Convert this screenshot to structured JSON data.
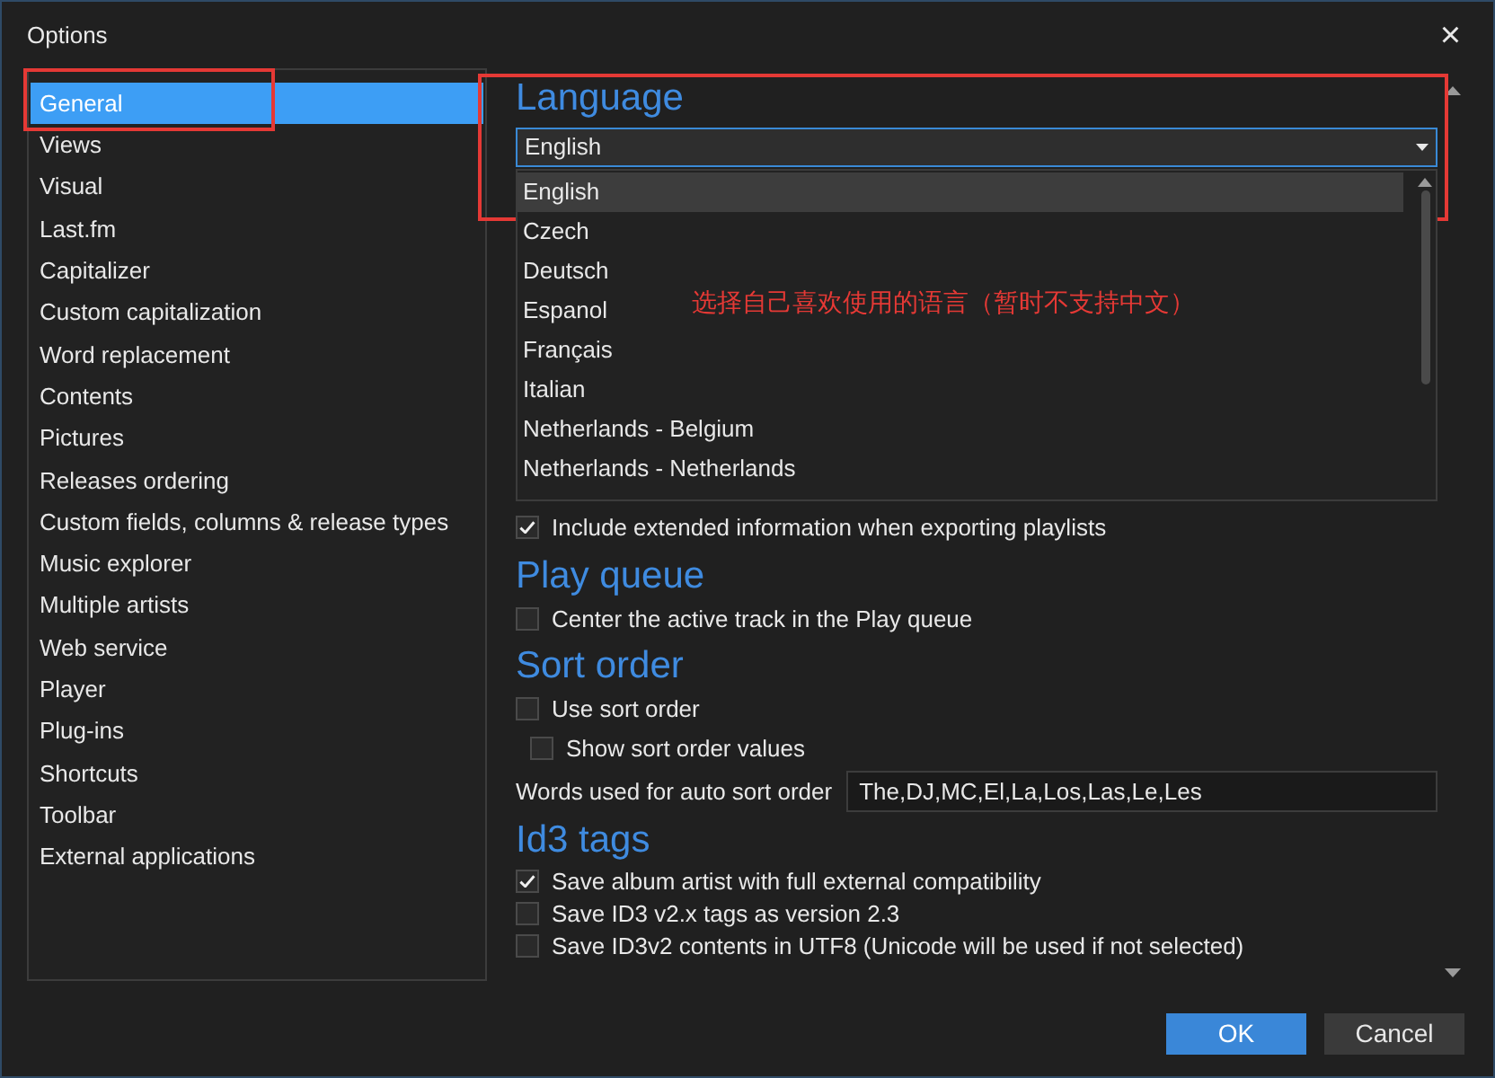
{
  "window": {
    "title": "Options",
    "close": "×"
  },
  "sidebar": {
    "items": [
      {
        "label": "General",
        "selected": true
      },
      {
        "label": "Views",
        "selected": false
      },
      {
        "label": "Visual",
        "selected": false
      },
      {
        "label": "Last.fm",
        "selected": false
      },
      {
        "label": "Capitalizer",
        "selected": false
      },
      {
        "label": "Custom capitalization",
        "selected": false
      },
      {
        "label": "Word replacement",
        "selected": false
      },
      {
        "label": "Contents",
        "selected": false
      },
      {
        "label": "Pictures",
        "selected": false
      },
      {
        "label": "Releases ordering",
        "selected": false
      },
      {
        "label": "Custom fields, columns & release types",
        "selected": false
      },
      {
        "label": "Music explorer",
        "selected": false
      },
      {
        "label": "Multiple artists",
        "selected": false
      },
      {
        "label": "Web service",
        "selected": false
      },
      {
        "label": "Player",
        "selected": false
      },
      {
        "label": "Plug-ins",
        "selected": false
      },
      {
        "label": "Shortcuts",
        "selected": false
      },
      {
        "label": "Toolbar",
        "selected": false
      },
      {
        "label": "External applications",
        "selected": false
      }
    ]
  },
  "language": {
    "heading": "Language",
    "value": "English",
    "expanded": true,
    "options": [
      {
        "label": "English",
        "selected": true
      },
      {
        "label": "Czech",
        "selected": false
      },
      {
        "label": "Deutsch",
        "selected": false
      },
      {
        "label": "Espanol",
        "selected": false
      },
      {
        "label": "Français",
        "selected": false
      },
      {
        "label": "Italian",
        "selected": false
      },
      {
        "label": "Netherlands - Belgium",
        "selected": false
      },
      {
        "label": "Netherlands - Netherlands",
        "selected": false
      }
    ]
  },
  "general_options": [
    {
      "label": "Include extended information when exporting playlists",
      "checked": true
    }
  ],
  "play_queue": {
    "heading": "Play queue",
    "options": [
      {
        "label": "Center the active track in the Play queue",
        "checked": false
      }
    ]
  },
  "sort_order": {
    "heading": "Sort order",
    "options": [
      {
        "label": "Use sort order",
        "checked": false,
        "children": [
          {
            "label": "Show sort order values",
            "checked": false
          }
        ]
      }
    ],
    "words_field": {
      "label": "Words used for auto sort order",
      "value": "The,DJ,MC,El,La,Los,Las,Le,Les"
    }
  },
  "id3_tags": {
    "heading": "Id3 tags",
    "options": [
      {
        "label": "Save album artist with full external compatibility",
        "checked": true
      },
      {
        "label": "Save ID3 v2.x tags as version 2.3",
        "checked": false
      },
      {
        "label": "Save ID3v2 contents in UTF8 (Unicode will be used if not selected)",
        "checked": false
      }
    ]
  },
  "annotation": {
    "note": "选择自己喜欢使用的语言（暂时不支持中文）"
  },
  "buttons": [
    {
      "label": "OK",
      "kind": "primary"
    },
    {
      "label": "Cancel",
      "kind": "secondary"
    }
  ]
}
